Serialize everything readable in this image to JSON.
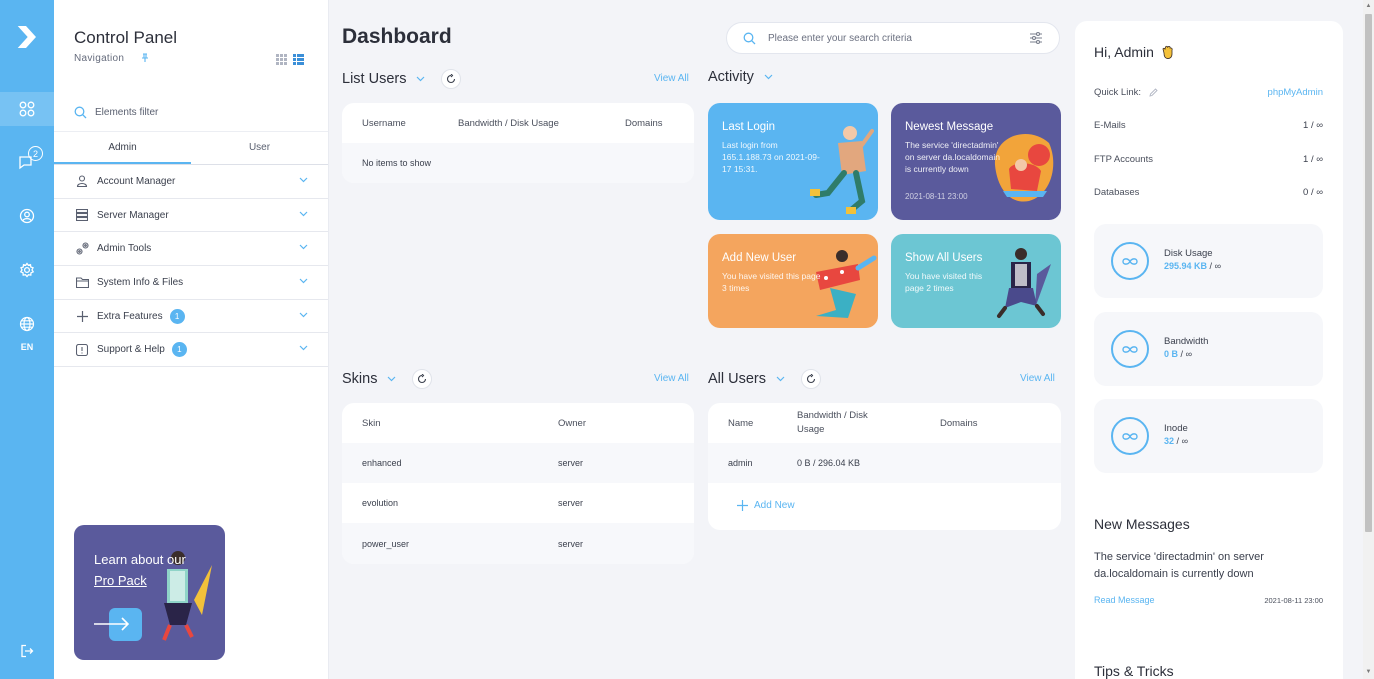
{
  "rail": {
    "lang": "EN",
    "messages_badge": "2",
    "icons": [
      "logo-icon",
      "dashboard-icon",
      "messages-icon",
      "account-icon",
      "settings-icon",
      "globe-icon",
      "logout-icon"
    ]
  },
  "nav": {
    "title": "Control Panel",
    "subtitle": "Navigation",
    "filter_placeholder": "Elements filter",
    "tabs": [
      {
        "label": "Admin"
      },
      {
        "label": "User"
      }
    ],
    "items": [
      {
        "label": "Account Manager",
        "icon": "user-icon",
        "badge": ""
      },
      {
        "label": "Server Manager",
        "icon": "server-icon",
        "badge": ""
      },
      {
        "label": "Admin Tools",
        "icon": "tools-icon",
        "badge": ""
      },
      {
        "label": "System Info & Files",
        "icon": "folder-icon",
        "badge": ""
      },
      {
        "label": "Extra Features",
        "icon": "plus-icon",
        "badge": "1"
      },
      {
        "label": "Support & Help",
        "icon": "help-icon",
        "badge": "1"
      }
    ],
    "promo": {
      "line1": "Learn about our",
      "line2": "Pro Pack"
    }
  },
  "main": {
    "title": "Dashboard",
    "search_placeholder": "Please enter your search criteria",
    "view_all": "View All",
    "list_users": {
      "title": "List Users",
      "columns": [
        "Username",
        "Bandwidth / Disk Usage",
        "Domains"
      ],
      "empty": "No items to show"
    },
    "activity": {
      "title": "Activity",
      "tiles": [
        {
          "title": "Last Login",
          "desc": "Last login from 165.1.188.73 on 2021-09-17 15:31.",
          "color": "#5ab5f1"
        },
        {
          "title": "Newest Message",
          "desc": "The service 'directadmin' on server da.localdomain is currently down",
          "date": "2021-08-11 23:00",
          "color": "#5a5a9c"
        },
        {
          "title": "Add New User",
          "desc": "You have visited this page 3 times",
          "color": "#f4a55e"
        },
        {
          "title": "Show All Users",
          "desc": "You have visited this page 2 times",
          "color": "#6cc6d3"
        }
      ]
    },
    "skins": {
      "title": "Skins",
      "columns": [
        "Skin",
        "Owner"
      ],
      "rows": [
        {
          "skin": "enhanced",
          "owner": "server"
        },
        {
          "skin": "evolution",
          "owner": "server"
        },
        {
          "skin": "power_user",
          "owner": "server"
        }
      ]
    },
    "all_users": {
      "title": "All Users",
      "columns": [
        "Name",
        "Bandwidth / Disk Usage",
        "Domains"
      ],
      "rows": [
        {
          "name": "admin",
          "usage": "0 B / 296.04 KB",
          "domains": ""
        }
      ],
      "add_new": "Add New"
    }
  },
  "right": {
    "greeting": "Hi, Admin",
    "quick_link_label": "Quick Link:",
    "quick_link_value": "phpMyAdmin",
    "rows": [
      {
        "label": "E-Mails",
        "value": "1 / ∞"
      },
      {
        "label": "FTP Accounts",
        "value": "1 / ∞"
      },
      {
        "label": "Databases",
        "value": "0 / ∞"
      }
    ],
    "stats": [
      {
        "label": "Disk Usage",
        "used": "295.94 KB",
        "sep": "/",
        "limit": "∞"
      },
      {
        "label": "Bandwidth",
        "used": "0 B",
        "sep": "/",
        "limit": "∞"
      },
      {
        "label": "Inode",
        "used": "32",
        "sep": "/",
        "limit": "∞"
      }
    ],
    "new_messages_title": "New Messages",
    "message": "The service 'directadmin' on server da.localdomain is currently down",
    "read_message": "Read Message",
    "message_date": "2021-08-11 23:00",
    "tips_title": "Tips & Tricks"
  },
  "colors": {
    "accent": "#5ab5f1",
    "purple": "#5a5a9c",
    "orange": "#f4a55e",
    "teal": "#6cc6d3"
  }
}
